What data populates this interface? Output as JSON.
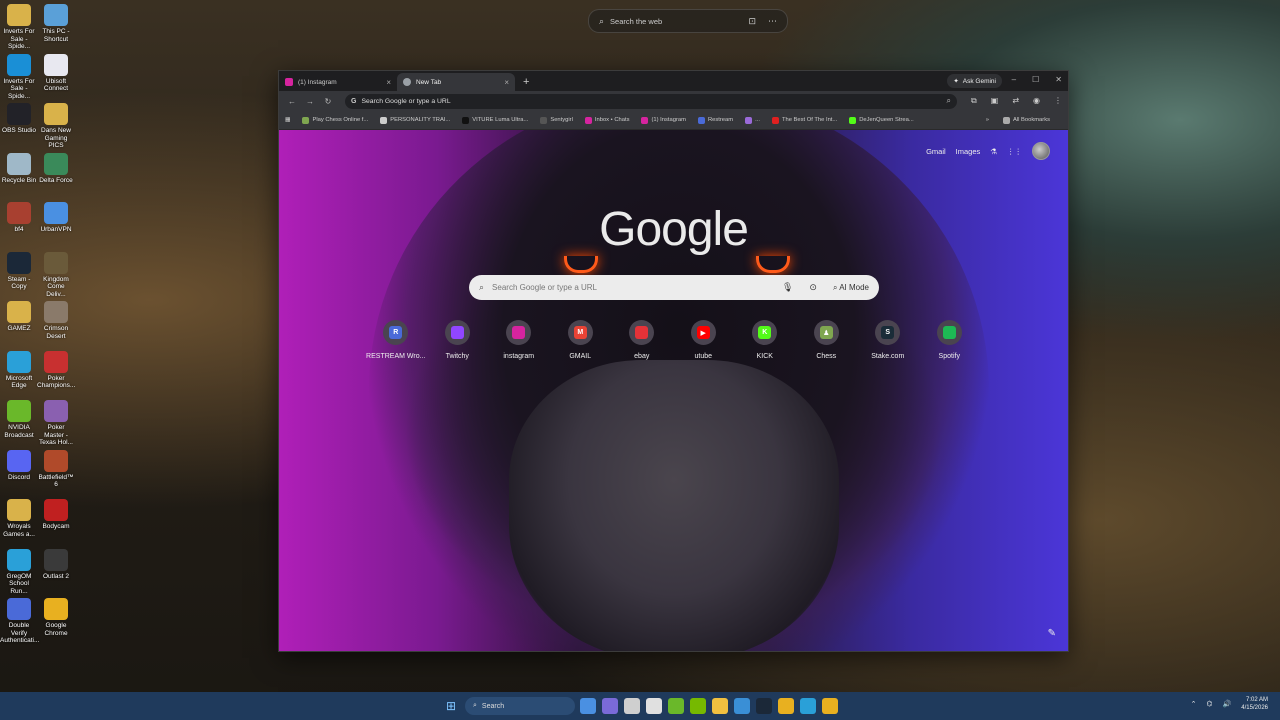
{
  "desktop": {
    "top_search_placeholder": "Search the web",
    "icons": [
      {
        "label": "Inverts For Sale - Spide...",
        "color": "#d9b24a"
      },
      {
        "label": "This PC - Shortcut",
        "color": "#5aa0d8"
      },
      {
        "label": "Inverts For Sale - Spide...",
        "color": "#1a8fd6"
      },
      {
        "label": "Ubisoft Connect",
        "color": "#e8e8f0"
      },
      {
        "label": "OBS Studio",
        "color": "#222228"
      },
      {
        "label": "Dans New Gaming PICS",
        "color": "#d9b24a"
      },
      {
        "label": "Recycle Bin",
        "color": "#9fb8c8"
      },
      {
        "label": "Delta Force",
        "color": "#3a8a5a"
      },
      {
        "label": "bf4",
        "color": "#a84030"
      },
      {
        "label": "UrbanVPN",
        "color": "#4a90e2"
      },
      {
        "label": "Steam - Copy",
        "color": "#1b2838"
      },
      {
        "label": "Kingdom Come Deliv...",
        "color": "#6a5a3a"
      },
      {
        "label": "GAMEZ",
        "color": "#d9b24a"
      },
      {
        "label": "Crimson Desert",
        "color": "#8a7a6a"
      },
      {
        "label": "Microsoft Edge",
        "color": "#2aa0d8"
      },
      {
        "label": "Poker Champions...",
        "color": "#c83030"
      },
      {
        "label": "NVIDIA Broadcast",
        "color": "#6ab82a"
      },
      {
        "label": "Poker Master - Texas Hol...",
        "color": "#8a60b0"
      },
      {
        "label": "Discord",
        "color": "#5865f2"
      },
      {
        "label": "Battlefield™ 6",
        "color": "#b04a2a"
      },
      {
        "label": "Wroyals Games a...",
        "color": "#d9b24a"
      },
      {
        "label": "Bodycam",
        "color": "#c02020"
      },
      {
        "label": "GregOM School Run...",
        "color": "#2aa0d8"
      },
      {
        "label": "Outlast 2",
        "color": "#3a3a3a"
      },
      {
        "label": "Double Verify Authenticati...",
        "color": "#4a6ad8"
      },
      {
        "label": "Google Chrome",
        "color": "#e8b020"
      }
    ]
  },
  "browser": {
    "tabs": [
      {
        "label": "(1) Instagram",
        "color": "#d6249f",
        "active": false
      },
      {
        "label": "New Tab",
        "color": "#9aa0a6",
        "active": true
      }
    ],
    "new_tab_symbol": "+",
    "ask_gemini": "Ask Gemini",
    "omnibox_text": "Search Google or type a URL",
    "bookmarks": [
      {
        "label": "Play Chess Online f...",
        "color": "#7fa650"
      },
      {
        "label": "PERSONALITY TRAI...",
        "color": "#cccccc"
      },
      {
        "label": "VITURE Luma Ultra...",
        "color": "#111111"
      },
      {
        "label": "Sentygirl",
        "color": "#555555"
      },
      {
        "label": "Inbox • Chats",
        "color": "#d6249f"
      },
      {
        "label": "(1) Instagram",
        "color": "#d6249f"
      },
      {
        "label": "Restream",
        "color": "#4a6ad8"
      },
      {
        "label": "...",
        "color": "#9a6ad8"
      },
      {
        "label": "The Best Of The Int...",
        "color": "#e02020"
      },
      {
        "label": "DeJenQueen Strea...",
        "color": "#53fc18"
      }
    ],
    "all_bookmarks": "All Bookmarks",
    "ntp": {
      "links": {
        "gmail": "Gmail",
        "images": "Images"
      },
      "logo": "Google",
      "search_placeholder": "Search Google or type a URL",
      "ai_mode": "AI Mode",
      "shortcuts": [
        {
          "label": "RESTREAM Wro...",
          "glyph": "R",
          "color": "#4a6ad8"
        },
        {
          "label": "Twitchy",
          "glyph": "",
          "color": "#9146ff"
        },
        {
          "label": "instagram",
          "glyph": "",
          "color": "#d6249f"
        },
        {
          "label": "GMAIL",
          "glyph": "M",
          "color": "#ea4335"
        },
        {
          "label": "ebay",
          "glyph": "",
          "color": "#e53238"
        },
        {
          "label": "utube",
          "glyph": "▶",
          "color": "#ff0000"
        },
        {
          "label": "KICK",
          "glyph": "K",
          "color": "#53fc18"
        },
        {
          "label": "Chess",
          "glyph": "♟",
          "color": "#7fa650"
        },
        {
          "label": "Stake.com",
          "glyph": "S",
          "color": "#1a2c38"
        },
        {
          "label": "Spotify",
          "glyph": "",
          "color": "#1db954"
        }
      ]
    }
  },
  "taskbar": {
    "search_placeholder": "Search",
    "time": "7:02 AM",
    "date": "4/15/2026",
    "apps": [
      "#4a90e2",
      "#7a6ad8",
      "#cfcfcf",
      "#e0e0e0",
      "#6ab82a",
      "#76b900",
      "#f0c040",
      "#3a8fd6",
      "#1b2838",
      "#e8b020",
      "#2aa0d8",
      "#e8b020"
    ]
  }
}
